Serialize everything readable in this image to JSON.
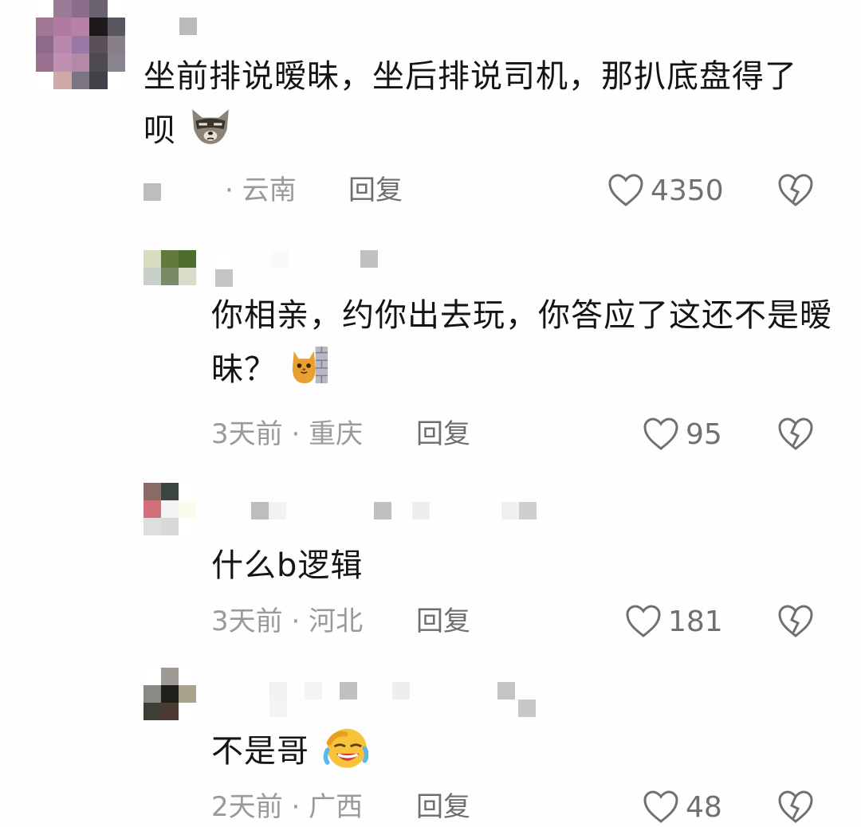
{
  "comments": [
    {
      "text": "坐前排说暧昧，坐后排说司机，那扒底盘得了呗",
      "time": "",
      "location": "· 云南",
      "reply": "回复",
      "likes": "4350",
      "emoji": "raccoon-face-icon"
    },
    {
      "text": "你相亲，约你出去玩，你答应了这还不是暧昧？",
      "time": "3天前",
      "location": "· 重庆",
      "reply": "回复",
      "likes": "95",
      "emoji": "cat-peeking-wall-icon"
    },
    {
      "text": "什么b逻辑",
      "time": "3天前",
      "location": "· 河北",
      "reply": "回复",
      "likes": "181",
      "emoji": ""
    },
    {
      "text": "不是哥",
      "time": "2天前",
      "location": "· 广西",
      "reply": "回复",
      "likes": "48",
      "emoji": "laughing-crying-face-icon"
    }
  ],
  "colors": {
    "text": "#141414",
    "meta": "#9a9a9a",
    "icon": "#707070",
    "background": "#fefefe"
  }
}
